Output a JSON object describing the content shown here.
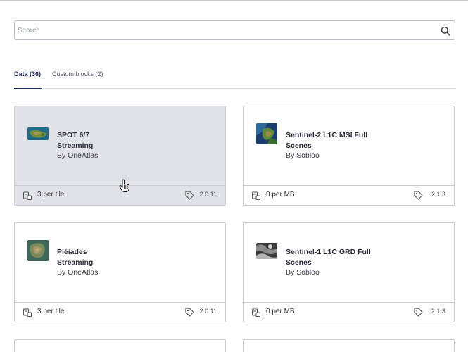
{
  "search": {
    "placeholder": "Search",
    "value": ""
  },
  "tabs": [
    {
      "label": "Data (36)",
      "active": true
    },
    {
      "label": "Custom blocks (2)",
      "active": false
    }
  ],
  "cards": [
    {
      "title_line1": "SPOT 6/7",
      "title_line2": "Streaming",
      "vendor": "By OneAtlas",
      "price": "3 per tile",
      "version": "2.0.11",
      "thumbnail": "spot-imagery-thumbnail"
    },
    {
      "title_line1": "Sentinel-2 L1C MSI Full",
      "title_line2": "Scenes",
      "vendor": "By Sobloo",
      "price": "0 per MB",
      "version": "2.1.3",
      "thumbnail": "sentinel2-imagery-thumbnail"
    },
    {
      "title_line1": "Pléiades",
      "title_line2": "Streaming",
      "vendor": "By OneAtlas",
      "price": "3 per tile",
      "version": "2.0.11",
      "thumbnail": "pleiades-imagery-thumbnail"
    },
    {
      "title_line1": "Sentinel-1 L1C GRD Full",
      "title_line2": "Scenes",
      "vendor": "By Sobloo",
      "price": "0 per MB",
      "version": "2.1.3",
      "thumbnail": "sentinel1-radar-thumbnail"
    }
  ],
  "icons": {
    "search": "search-icon",
    "price": "credits-icon",
    "version": "tag-icon",
    "cursor": "hand-pointer-icon"
  },
  "colors": {
    "accent": "#1f2a55",
    "card_hover_bg": "#e1e2e8",
    "border": "#c9ccd3"
  }
}
